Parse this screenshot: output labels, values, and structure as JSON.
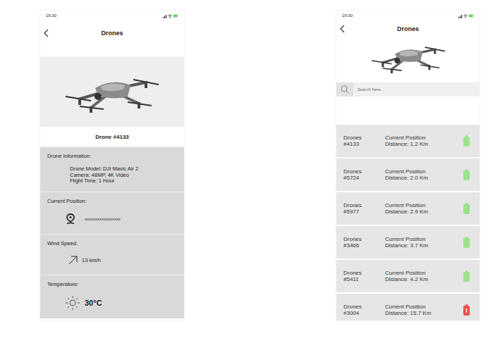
{
  "detail_screen": {
    "status_time": "19:30",
    "title": "Drones",
    "drone_name": "Drone #4133",
    "sections": [
      {
        "label": "Drone Information:",
        "kind": "info",
        "lines": [
          "Drone Model: DJI Mavic Air 2",
          "Camera: 48MP, 4K Video",
          "Flight Time: 1 Hour"
        ]
      },
      {
        "label": "Current Position:",
        "kind": "position",
        "value": "xxxxxxxxxxxxxxxxx"
      },
      {
        "label": "Wind Speed:",
        "kind": "wind",
        "value": "13 km/h"
      },
      {
        "label": "Temperature:",
        "kind": "temperature",
        "value": "30°C"
      }
    ]
  },
  "list_screen": {
    "status_time": "19:30",
    "title": "Drones",
    "search": {
      "placeholder": "Search here..."
    },
    "drones": [
      {
        "name": "Drones #4133",
        "position": "Current Position",
        "distance": "Distance: 1.2 Km",
        "color": "#9be38a",
        "mark": ""
      },
      {
        "name": "Drones #5724",
        "position": "Current Position",
        "distance": "Distance: 2.0 Km",
        "color": "#9be38a",
        "mark": ""
      },
      {
        "name": "Drones #5977",
        "position": "Current Position",
        "distance": "Distance: 2.9 Km",
        "color": "#9be38a",
        "mark": ""
      },
      {
        "name": "Drones #3466",
        "position": "Current Position",
        "distance": "Distance: 3.7 Km",
        "color": "#9be38a",
        "mark": ""
      },
      {
        "name": "Drones #5411",
        "position": "Current Position",
        "distance": "Distance: 4.2 Km",
        "color": "#9be38a",
        "mark": ""
      },
      {
        "name": "Drones #3004",
        "position": "Current Position",
        "distance": "Distance: 15.7 Km",
        "color": "#e8504f",
        "mark": "!"
      }
    ]
  }
}
